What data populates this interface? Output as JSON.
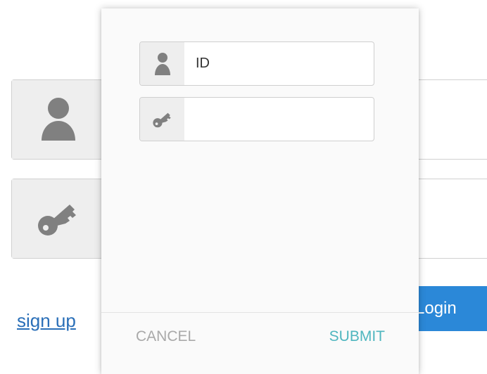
{
  "background_form": {
    "username_icon": "user-icon",
    "password_icon": "key-icon",
    "signup_label": "sign up",
    "login_label": "Login"
  },
  "modal": {
    "id_field": {
      "icon": "user-icon",
      "value": "ID"
    },
    "password_field": {
      "icon": "key-icon",
      "value": ""
    },
    "cancel_label": "CANCEL",
    "submit_label": "SUBMIT"
  },
  "colors": {
    "link": "#2a6fb8",
    "primary_button": "#2b88d8",
    "submit": "#4fb6bf",
    "cancel": "#a9a9a9",
    "icon_gray": "#808080",
    "icon_bg": "#eeeeee"
  }
}
